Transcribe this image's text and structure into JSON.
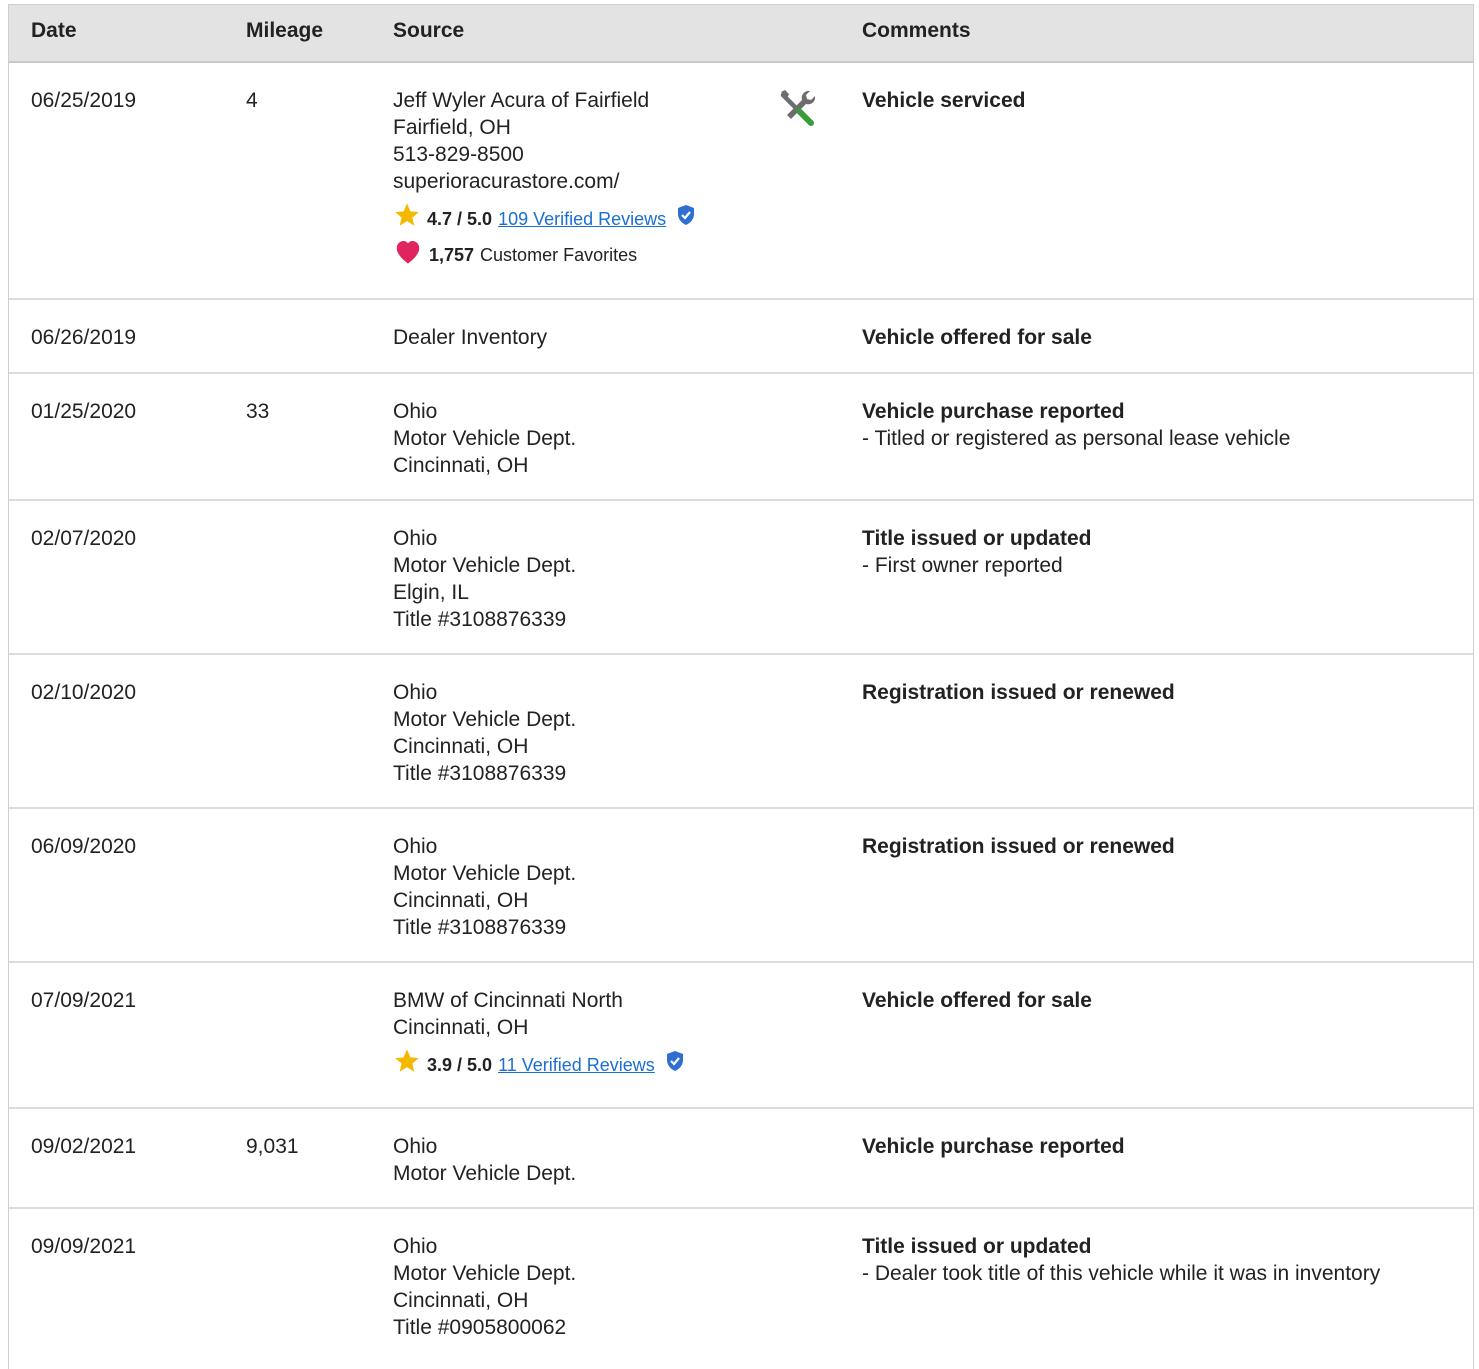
{
  "headers": {
    "date": "Date",
    "mileage": "Mileage",
    "source": "Source",
    "comments": "Comments"
  },
  "rows": [
    {
      "date": "06/25/2019",
      "mileage": "4",
      "source": [
        "Jeff Wyler Acura of Fairfield",
        "Fairfield, OH",
        "513-829-8500",
        "superioracurastore.com/"
      ],
      "rating": {
        "score": "4.7 / 5.0",
        "reviews": "109 Verified Reviews"
      },
      "favorites": {
        "count": "1,757",
        "label": "Customer Favorites"
      },
      "service_icon": "wrench-screwdriver-icon",
      "comment_title": "Vehicle serviced",
      "comment_detail": ""
    },
    {
      "date": "06/26/2019",
      "mileage": "",
      "source": [
        "Dealer Inventory"
      ],
      "comment_title": "Vehicle offered for sale",
      "comment_detail": ""
    },
    {
      "date": "01/25/2020",
      "mileage": "33",
      "source": [
        "Ohio",
        "Motor Vehicle Dept.",
        "Cincinnati, OH"
      ],
      "comment_title": "Vehicle purchase reported",
      "comment_detail": "- Titled or registered as personal lease vehicle"
    },
    {
      "date": "02/07/2020",
      "mileage": "",
      "source": [
        "Ohio",
        "Motor Vehicle Dept.",
        "Elgin, IL",
        "Title #3108876339"
      ],
      "comment_title": "Title issued or updated",
      "comment_detail": "- First owner reported"
    },
    {
      "date": "02/10/2020",
      "mileage": "",
      "source": [
        "Ohio",
        "Motor Vehicle Dept.",
        "Cincinnati, OH",
        "Title #3108876339"
      ],
      "comment_title": "Registration issued or renewed",
      "comment_detail": ""
    },
    {
      "date": "06/09/2020",
      "mileage": "",
      "source": [
        "Ohio",
        "Motor Vehicle Dept.",
        "Cincinnati, OH",
        "Title #3108876339"
      ],
      "comment_title": "Registration issued or renewed",
      "comment_detail": ""
    },
    {
      "date": "07/09/2021",
      "mileage": "",
      "source": [
        "BMW of Cincinnati North",
        "Cincinnati, OH"
      ],
      "rating": {
        "score": "3.9 / 5.0",
        "reviews": "11 Verified Reviews"
      },
      "comment_title": "Vehicle offered for sale",
      "comment_detail": ""
    },
    {
      "date": "09/02/2021",
      "mileage": "9,031",
      "source": [
        "Ohio",
        "Motor Vehicle Dept."
      ],
      "comment_title": "Vehicle purchase reported",
      "comment_detail": ""
    },
    {
      "date": "09/09/2021",
      "mileage": "",
      "source": [
        "Ohio",
        "Motor Vehicle Dept.",
        "Cincinnati, OH",
        "Title #0905800062"
      ],
      "comment_title": "Title issued or updated",
      "comment_detail": "- Dealer took title of this vehicle while it was in inventory"
    }
  ],
  "colors": {
    "header_bg": "#e3e3e3",
    "link": "#1a6fd0",
    "star": "#f5b800",
    "heart": "#e0245e",
    "shield": "#2f6fd1"
  }
}
